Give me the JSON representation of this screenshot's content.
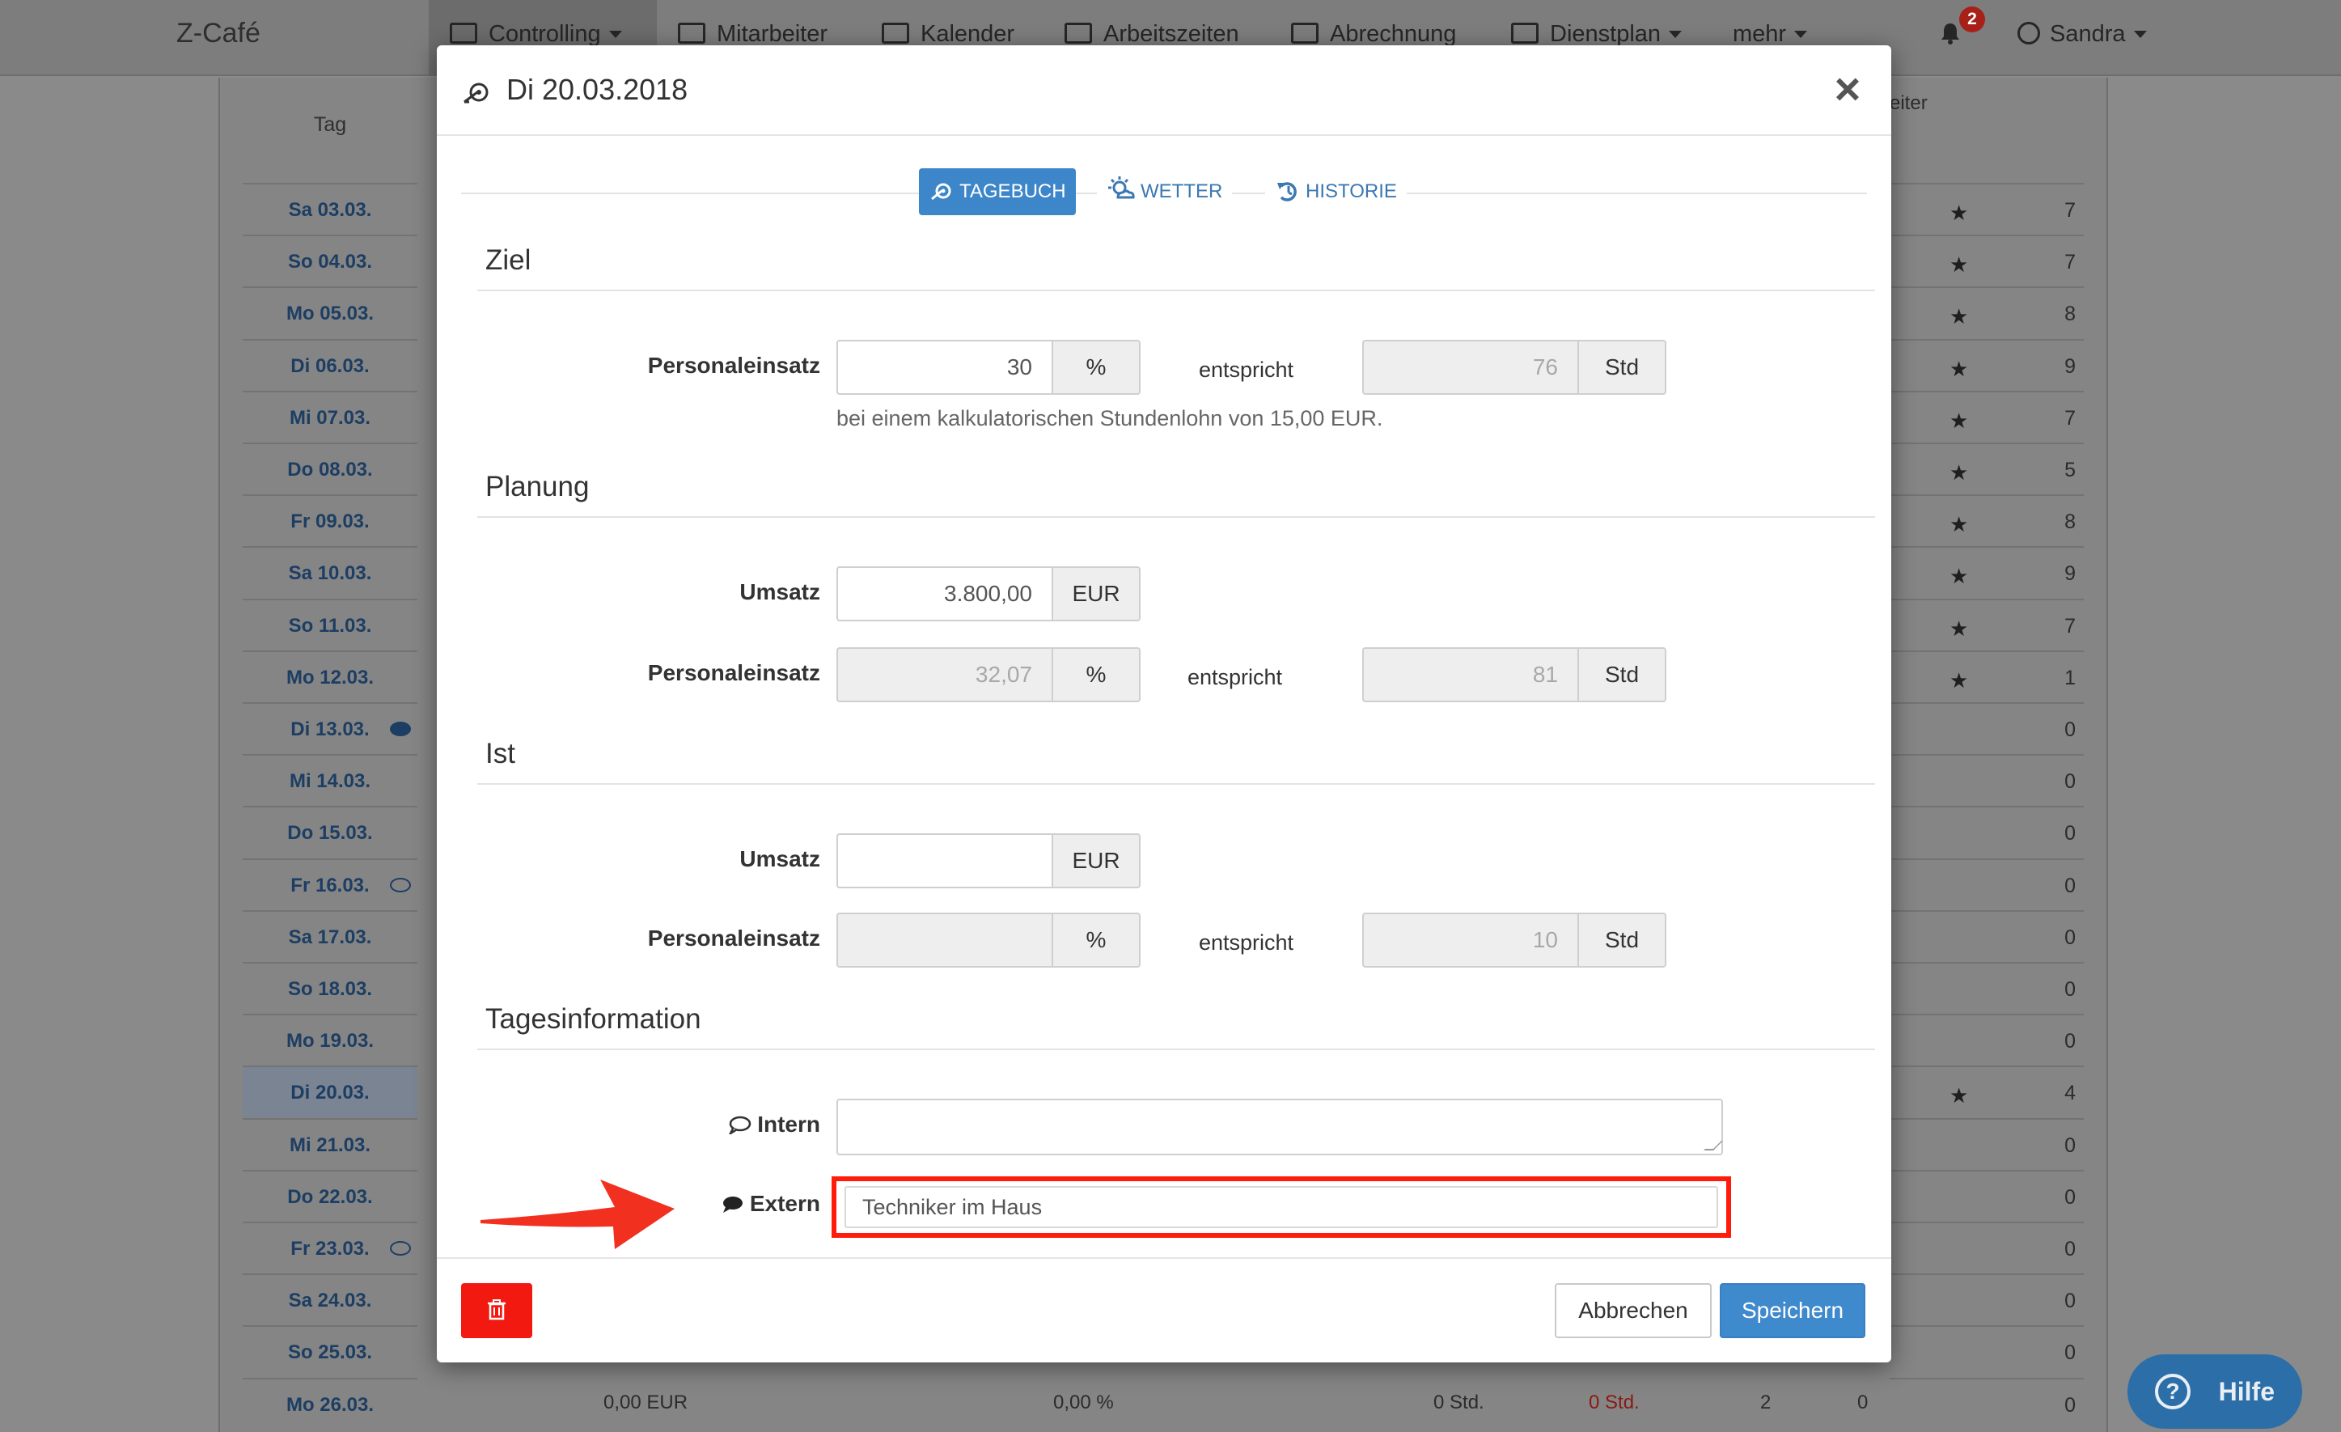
{
  "app": {
    "brand": "Z-Café",
    "nav": [
      {
        "label": "Controlling",
        "icon": "chart-icon",
        "dropdown": true
      },
      {
        "label": "Mitarbeiter",
        "icon": "users-icon"
      },
      {
        "label": "Kalender",
        "icon": "calendar-icon"
      },
      {
        "label": "Arbeitszeiten",
        "icon": "clock-icon"
      },
      {
        "label": "Abrechnung",
        "icon": "grid-icon"
      },
      {
        "label": "Dienstplan",
        "icon": "schedule-icon",
        "dropdown": true
      },
      {
        "label": "mehr",
        "dropdown": true
      }
    ],
    "notifications_count": "2",
    "user_name": "Sandra",
    "help_label": "Hilfe"
  },
  "table": {
    "day_header": "Tag",
    "right_header": "eiter",
    "days": [
      "Sa 03.03.",
      "So 04.03.",
      "Mo 05.03.",
      "Di 06.03.",
      "Mi 07.03.",
      "Do 08.03.",
      "Fr 09.03.",
      "Sa 10.03.",
      "So 11.03.",
      "Mo 12.03.",
      "Di 13.03.",
      "Mi 14.03.",
      "Do 15.03.",
      "Fr 16.03.",
      "Sa 17.03.",
      "So 18.03.",
      "Mo 19.03.",
      "Di 20.03.",
      "Mi 21.03.",
      "Do 22.03.",
      "Fr 23.03.",
      "Sa 24.03.",
      "So 25.03.",
      "Mo 26.03."
    ],
    "right_counts": [
      "7",
      "7",
      "8",
      "9",
      "7",
      "5",
      "8",
      "9",
      "7",
      "1",
      "0",
      "0",
      "0",
      "0",
      "0",
      "0",
      "0",
      "4",
      "0",
      "0",
      "0",
      "0",
      "0",
      "0"
    ],
    "bottom_row": {
      "umsatz": "0,00 EUR",
      "percent": "0,00 %",
      "std": "0 Std.",
      "std_red": "0 Std.",
      "count1": "2",
      "count2": "0"
    }
  },
  "modal": {
    "title": "Di 20.03.2018",
    "tabs": {
      "tagebuch": "TAGEBUCH",
      "wetter": "WETTER",
      "historie": "HISTORIE"
    },
    "ziel": {
      "title": "Ziel",
      "personaleinsatz_label": "Personaleinsatz",
      "personaleinsatz_value": "30",
      "percent_unit": "%",
      "entspricht": "entspricht",
      "std_value": "76",
      "std_unit": "Std",
      "help": "bei einem kalkulatorischen Stundenlohn von 15,00 EUR."
    },
    "planung": {
      "title": "Planung",
      "umsatz_label": "Umsatz",
      "umsatz_value": "3.800,00",
      "currency": "EUR",
      "personaleinsatz_label": "Personaleinsatz",
      "personaleinsatz_value": "32,07",
      "percent_unit": "%",
      "entspricht": "entspricht",
      "std_value": "81",
      "std_unit": "Std"
    },
    "ist": {
      "title": "Ist",
      "umsatz_label": "Umsatz",
      "umsatz_value": "",
      "currency": "EUR",
      "personaleinsatz_label": "Personaleinsatz",
      "personaleinsatz_value": "",
      "percent_unit": "%",
      "entspricht": "entspricht",
      "std_value": "10",
      "std_unit": "Std"
    },
    "tagesinformation": {
      "title": "Tagesinformation",
      "intern_label": "Intern",
      "intern_value": "",
      "extern_label": "Extern",
      "extern_value": "Techniker im Haus"
    },
    "footer": {
      "cancel_label": "Abbrechen",
      "save_label": "Speichern"
    }
  },
  "colors": {
    "primary": "#3f89cd",
    "danger": "#f21a10",
    "highlight": "#ff1c0d"
  }
}
